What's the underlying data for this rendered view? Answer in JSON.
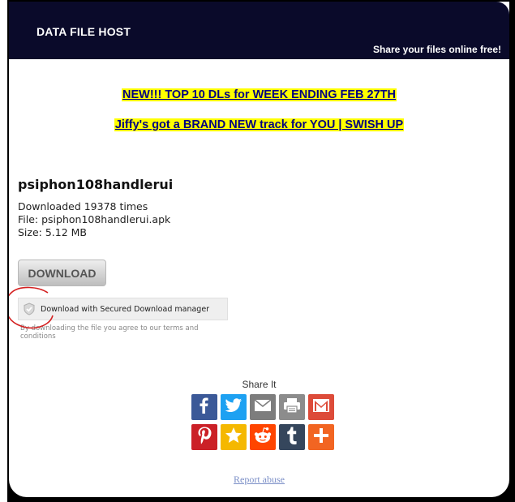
{
  "header": {
    "site_title": "DATA FILE HOST",
    "tagline": "Share your files online free!"
  },
  "promos": [
    {
      "text": "NEW!!! TOP 10 DLs for WEEK ENDING FEB 27TH"
    },
    {
      "text": "Jiffy's got a BRAND NEW track for YOU | SWISH UP"
    }
  ],
  "file": {
    "name": "psiphon108handlerui",
    "downloaded": "Downloaded 19378 times",
    "filename": "File: psiphon108handlerui.apk",
    "size": "Size: 5.12 MB"
  },
  "download_button": {
    "label": "DOWNLOAD"
  },
  "secure_download": {
    "label": "Download with Secured Download manager",
    "terms": "By downloading the file you agree to our terms and conditions"
  },
  "share": {
    "label": "Share It",
    "buttons": [
      {
        "icon": "facebook-icon",
        "color": "#3b5998"
      },
      {
        "icon": "twitter-icon",
        "color": "#1da1f2"
      },
      {
        "icon": "email-icon",
        "color": "#7d7d7d"
      },
      {
        "icon": "print-icon",
        "color": "#8c8c8c"
      },
      {
        "icon": "gmail-icon",
        "color": "#dd4b39"
      },
      {
        "icon": "pinterest-icon",
        "color": "#cb2027"
      },
      {
        "icon": "favorites-icon",
        "color": "#f5b800"
      },
      {
        "icon": "reddit-icon",
        "color": "#ff4500"
      },
      {
        "icon": "tumblr-icon",
        "color": "#35465c"
      },
      {
        "icon": "more-icon",
        "color": "#f26522"
      }
    ]
  },
  "report_abuse": {
    "label": "Report abuse"
  }
}
